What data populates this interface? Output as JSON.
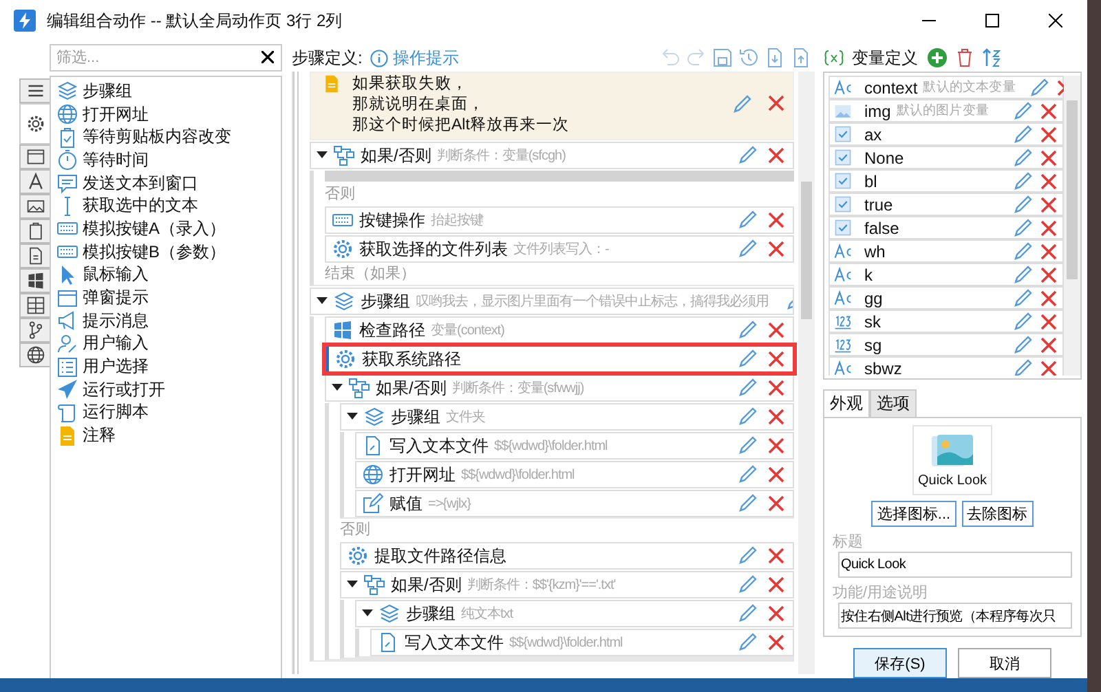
{
  "window": {
    "title": "编辑组合动作 -- 默认全局动作页 3行 2列"
  },
  "library": {
    "filter": {
      "placeholder": "筛选..."
    },
    "categories": [
      {
        "kind": "menu",
        "selected": false
      },
      {
        "kind": "gear",
        "selected": true
      },
      {
        "kind": "window",
        "selected": false
      },
      {
        "kind": "font",
        "selected": false
      },
      {
        "kind": "image",
        "selected": false
      },
      {
        "kind": "clipboard",
        "selected": false
      },
      {
        "kind": "document",
        "selected": false
      },
      {
        "kind": "windows",
        "selected": false
      },
      {
        "kind": "grid",
        "selected": false
      },
      {
        "kind": "branch",
        "selected": false
      },
      {
        "kind": "globe",
        "selected": false
      }
    ],
    "items": [
      {
        "kind": "layers",
        "label": "步骤组"
      },
      {
        "kind": "globe",
        "label": "打开网址"
      },
      {
        "kind": "clipcheck",
        "label": "等待剪贴板内容改变"
      },
      {
        "kind": "timer",
        "label": "等待时间"
      },
      {
        "kind": "bubble",
        "label": "发送文本到窗口"
      },
      {
        "kind": "cursor",
        "label": "获取选中的文本"
      },
      {
        "kind": "keyboard",
        "label": "模拟按键A（录入）"
      },
      {
        "kind": "keyboard",
        "label": "模拟按键B（参数）"
      },
      {
        "kind": "pointer",
        "label": "鼠标输入"
      },
      {
        "kind": "window",
        "label": "弹窗提示"
      },
      {
        "kind": "megaphone",
        "label": "提示消息"
      },
      {
        "kind": "user",
        "label": "用户输入"
      },
      {
        "kind": "checklist",
        "label": "用户选择"
      },
      {
        "kind": "plane",
        "label": "运行或打开"
      },
      {
        "kind": "scroll",
        "label": "运行脚本"
      },
      {
        "kind": "note",
        "label": "注释"
      }
    ]
  },
  "steps": {
    "heading": "步骤定义:",
    "hint": "操作提示",
    "toolbar": [
      {
        "kind": "undo",
        "disabled": true
      },
      {
        "kind": "redo",
        "disabled": true
      },
      {
        "kind": "save",
        "disabled": false
      },
      {
        "kind": "history",
        "disabled": false
      },
      {
        "kind": "import",
        "disabled": false
      },
      {
        "kind": "export",
        "disabled": false
      }
    ],
    "tree": [
      {
        "kind": "note",
        "selected": false,
        "lines": [
          "如果获取失败，",
          "那就说明在桌面，",
          "那这个时候把Alt释放再来一次"
        ]
      },
      {
        "kind": "if",
        "title": "如果/否则",
        "detail": "判断条件：变量(sfcgh)",
        "expanded": true,
        "selected": false,
        "children": [
          {
            "kind": "branch"
          },
          {
            "kind": "label",
            "text": "否则"
          },
          {
            "kind": "keyboard",
            "title": "按键操作",
            "detail": "抬起按键",
            "selected": false
          },
          {
            "kind": "gear",
            "title": "获取选择的文件列表",
            "detail": "文件列表写入：-",
            "selected": false
          },
          {
            "kind": "label",
            "text": "结束（如果）"
          }
        ]
      },
      {
        "kind": "group",
        "title": "步骤组",
        "detail": "叹哟我去，显示图片里面有一个错误中止标志，搞得我必须用",
        "expanded": true,
        "selected": false,
        "children": [
          {
            "kind": "windows",
            "title": "检查路径",
            "detail": "变量(context)",
            "selected": false
          },
          {
            "kind": "gear",
            "title": "获取系统路径",
            "selected": true
          },
          {
            "kind": "if",
            "title": "如果/否则",
            "detail": "判断条件：变量(sfwwjj)",
            "expanded": true,
            "selected": false,
            "children": [
              {
                "kind": "group",
                "title": "步骤组",
                "detail": "文件夹",
                "expanded": true,
                "selected": false,
                "children": [
                  {
                    "kind": "file",
                    "title": "写入文本文件",
                    "detail": "$${wdwd}\\folder.html",
                    "selected": false
                  },
                  {
                    "kind": "globe",
                    "title": "打开网址",
                    "detail": "$${wdwd}\\folder.html",
                    "selected": false
                  },
                  {
                    "kind": "assign",
                    "title": "赋值",
                    "detail": "=>{wjlx}",
                    "selected": false
                  }
                ]
              },
              {
                "kind": "label",
                "text": "否则"
              },
              {
                "kind": "gear",
                "title": "提取文件路径信息",
                "selected": false
              },
              {
                "kind": "if",
                "title": "如果/否则",
                "detail": "判断条件：$$'{kzm}'=='.txt'",
                "expanded": true,
                "selected": false,
                "children": [
                  {
                    "kind": "group",
                    "title": "步骤组",
                    "detail": "纯文本txt",
                    "expanded": true,
                    "selected": false,
                    "children": [
                      {
                        "kind": "file",
                        "title": "写入文本文件",
                        "detail": "$${wdwd}\\folder.html",
                        "selected": false
                      }
                    ]
                  }
                ]
              }
            ]
          }
        ]
      }
    ]
  },
  "variables": {
    "heading": "变量定义",
    "items": [
      {
        "kind": "text",
        "name": "context",
        "note": "默认的文本变量"
      },
      {
        "kind": "image",
        "name": "img",
        "note": "默认的图片变量"
      },
      {
        "kind": "bool",
        "name": "ax"
      },
      {
        "kind": "bool",
        "name": "None"
      },
      {
        "kind": "bool",
        "name": "bl"
      },
      {
        "kind": "bool",
        "name": "true"
      },
      {
        "kind": "bool",
        "name": "false"
      },
      {
        "kind": "text",
        "name": "wh"
      },
      {
        "kind": "text",
        "name": "k"
      },
      {
        "kind": "text",
        "name": "gg"
      },
      {
        "kind": "number",
        "name": "sk"
      },
      {
        "kind": "number",
        "name": "sg"
      },
      {
        "kind": "text",
        "name": "sbwz"
      }
    ]
  },
  "appearance": {
    "tabs": [
      {
        "label": "外观",
        "selected": true
      },
      {
        "label": "选项",
        "selected": false
      }
    ],
    "preview_label": "Quick Look",
    "icon_buttons": [
      "选择图标...",
      "去除图标"
    ],
    "fields": [
      {
        "label": "标题",
        "value": "Quick Look"
      },
      {
        "label": "功能/用途说明",
        "value": "按住右侧Alt进行预览（本程序每次只"
      }
    ]
  },
  "buttons": [
    {
      "label": "保存(S)",
      "default": true
    },
    {
      "label": "取消",
      "default": false
    }
  ]
}
